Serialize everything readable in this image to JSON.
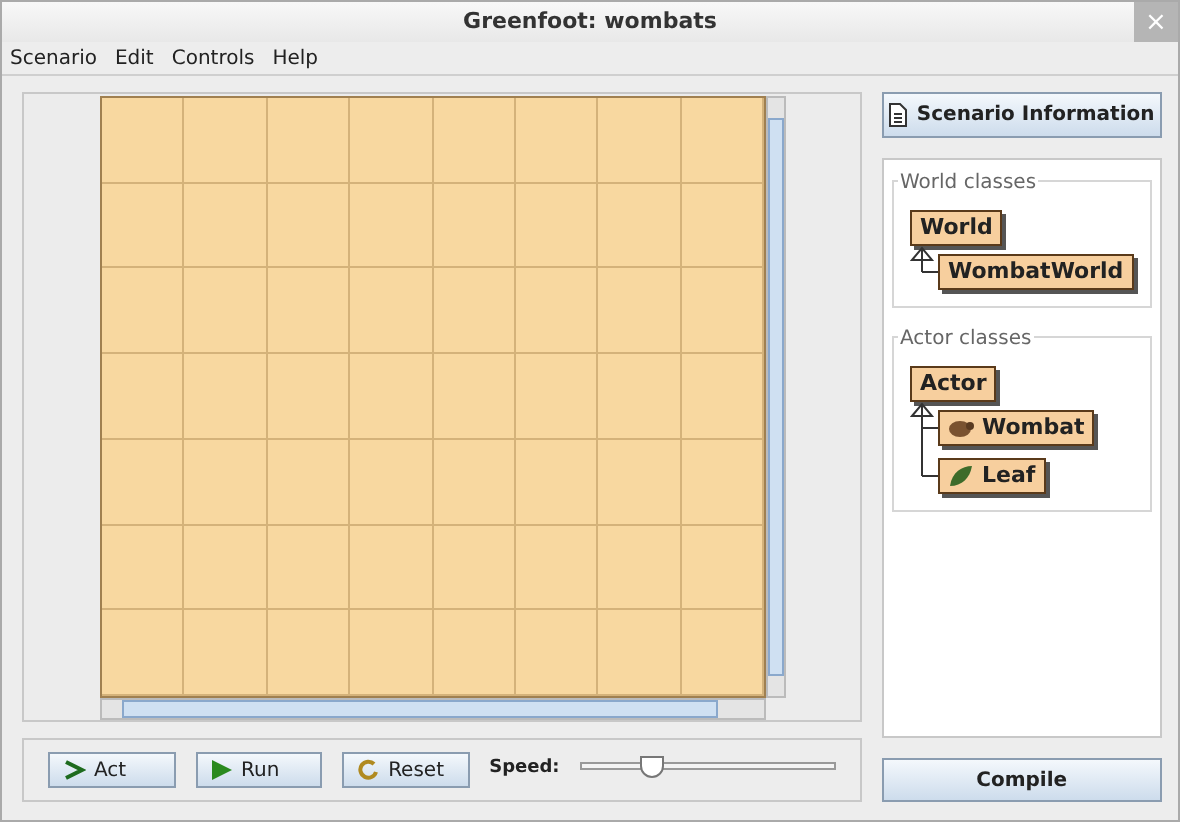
{
  "window": {
    "title": "Greenfoot: wombats",
    "close": "×"
  },
  "menu": [
    {
      "label": "Scenario"
    },
    {
      "label": "Edit"
    },
    {
      "label": "Controls"
    },
    {
      "label": "Help"
    }
  ],
  "controls": {
    "buttons": [
      {
        "kind": "act",
        "label": "Act"
      },
      {
        "kind": "run",
        "label": "Run"
      },
      {
        "kind": "reset",
        "label": "Reset"
      }
    ],
    "speed": {
      "label": "Speed:",
      "level": 0.28
    }
  },
  "scenario_button": "Scenario Information",
  "world_classes": {
    "title": "World classes",
    "root": "World",
    "children": [
      {
        "label": "WombatWorld"
      }
    ]
  },
  "actor_classes": {
    "title": "Actor classes",
    "root": "Actor",
    "children": [
      {
        "label": "Wombat",
        "kind": "wombat"
      },
      {
        "label": "Leaf",
        "kind": "leaf"
      }
    ]
  },
  "compile": "Compile"
}
